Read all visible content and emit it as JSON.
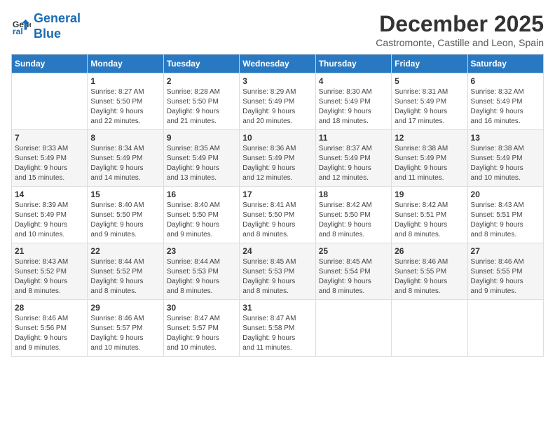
{
  "header": {
    "logo_line1": "General",
    "logo_line2": "Blue",
    "month": "December 2025",
    "location": "Castromonte, Castille and Leon, Spain"
  },
  "days_of_week": [
    "Sunday",
    "Monday",
    "Tuesday",
    "Wednesday",
    "Thursday",
    "Friday",
    "Saturday"
  ],
  "weeks": [
    [
      {
        "day": "",
        "info": ""
      },
      {
        "day": "1",
        "info": "Sunrise: 8:27 AM\nSunset: 5:50 PM\nDaylight: 9 hours\nand 22 minutes."
      },
      {
        "day": "2",
        "info": "Sunrise: 8:28 AM\nSunset: 5:50 PM\nDaylight: 9 hours\nand 21 minutes."
      },
      {
        "day": "3",
        "info": "Sunrise: 8:29 AM\nSunset: 5:49 PM\nDaylight: 9 hours\nand 20 minutes."
      },
      {
        "day": "4",
        "info": "Sunrise: 8:30 AM\nSunset: 5:49 PM\nDaylight: 9 hours\nand 18 minutes."
      },
      {
        "day": "5",
        "info": "Sunrise: 8:31 AM\nSunset: 5:49 PM\nDaylight: 9 hours\nand 17 minutes."
      },
      {
        "day": "6",
        "info": "Sunrise: 8:32 AM\nSunset: 5:49 PM\nDaylight: 9 hours\nand 16 minutes."
      }
    ],
    [
      {
        "day": "7",
        "info": "Sunrise: 8:33 AM\nSunset: 5:49 PM\nDaylight: 9 hours\nand 15 minutes."
      },
      {
        "day": "8",
        "info": "Sunrise: 8:34 AM\nSunset: 5:49 PM\nDaylight: 9 hours\nand 14 minutes."
      },
      {
        "day": "9",
        "info": "Sunrise: 8:35 AM\nSunset: 5:49 PM\nDaylight: 9 hours\nand 13 minutes."
      },
      {
        "day": "10",
        "info": "Sunrise: 8:36 AM\nSunset: 5:49 PM\nDaylight: 9 hours\nand 12 minutes."
      },
      {
        "day": "11",
        "info": "Sunrise: 8:37 AM\nSunset: 5:49 PM\nDaylight: 9 hours\nand 12 minutes."
      },
      {
        "day": "12",
        "info": "Sunrise: 8:38 AM\nSunset: 5:49 PM\nDaylight: 9 hours\nand 11 minutes."
      },
      {
        "day": "13",
        "info": "Sunrise: 8:38 AM\nSunset: 5:49 PM\nDaylight: 9 hours\nand 10 minutes."
      }
    ],
    [
      {
        "day": "14",
        "info": "Sunrise: 8:39 AM\nSunset: 5:49 PM\nDaylight: 9 hours\nand 10 minutes."
      },
      {
        "day": "15",
        "info": "Sunrise: 8:40 AM\nSunset: 5:50 PM\nDaylight: 9 hours\nand 9 minutes."
      },
      {
        "day": "16",
        "info": "Sunrise: 8:40 AM\nSunset: 5:50 PM\nDaylight: 9 hours\nand 9 minutes."
      },
      {
        "day": "17",
        "info": "Sunrise: 8:41 AM\nSunset: 5:50 PM\nDaylight: 9 hours\nand 8 minutes."
      },
      {
        "day": "18",
        "info": "Sunrise: 8:42 AM\nSunset: 5:50 PM\nDaylight: 9 hours\nand 8 minutes."
      },
      {
        "day": "19",
        "info": "Sunrise: 8:42 AM\nSunset: 5:51 PM\nDaylight: 9 hours\nand 8 minutes."
      },
      {
        "day": "20",
        "info": "Sunrise: 8:43 AM\nSunset: 5:51 PM\nDaylight: 9 hours\nand 8 minutes."
      }
    ],
    [
      {
        "day": "21",
        "info": "Sunrise: 8:43 AM\nSunset: 5:52 PM\nDaylight: 9 hours\nand 8 minutes."
      },
      {
        "day": "22",
        "info": "Sunrise: 8:44 AM\nSunset: 5:52 PM\nDaylight: 9 hours\nand 8 minutes."
      },
      {
        "day": "23",
        "info": "Sunrise: 8:44 AM\nSunset: 5:53 PM\nDaylight: 9 hours\nand 8 minutes."
      },
      {
        "day": "24",
        "info": "Sunrise: 8:45 AM\nSunset: 5:53 PM\nDaylight: 9 hours\nand 8 minutes."
      },
      {
        "day": "25",
        "info": "Sunrise: 8:45 AM\nSunset: 5:54 PM\nDaylight: 9 hours\nand 8 minutes."
      },
      {
        "day": "26",
        "info": "Sunrise: 8:46 AM\nSunset: 5:55 PM\nDaylight: 9 hours\nand 8 minutes."
      },
      {
        "day": "27",
        "info": "Sunrise: 8:46 AM\nSunset: 5:55 PM\nDaylight: 9 hours\nand 9 minutes."
      }
    ],
    [
      {
        "day": "28",
        "info": "Sunrise: 8:46 AM\nSunset: 5:56 PM\nDaylight: 9 hours\nand 9 minutes."
      },
      {
        "day": "29",
        "info": "Sunrise: 8:46 AM\nSunset: 5:57 PM\nDaylight: 9 hours\nand 10 minutes."
      },
      {
        "day": "30",
        "info": "Sunrise: 8:47 AM\nSunset: 5:57 PM\nDaylight: 9 hours\nand 10 minutes."
      },
      {
        "day": "31",
        "info": "Sunrise: 8:47 AM\nSunset: 5:58 PM\nDaylight: 9 hours\nand 11 minutes."
      },
      {
        "day": "",
        "info": ""
      },
      {
        "day": "",
        "info": ""
      },
      {
        "day": "",
        "info": ""
      }
    ]
  ]
}
